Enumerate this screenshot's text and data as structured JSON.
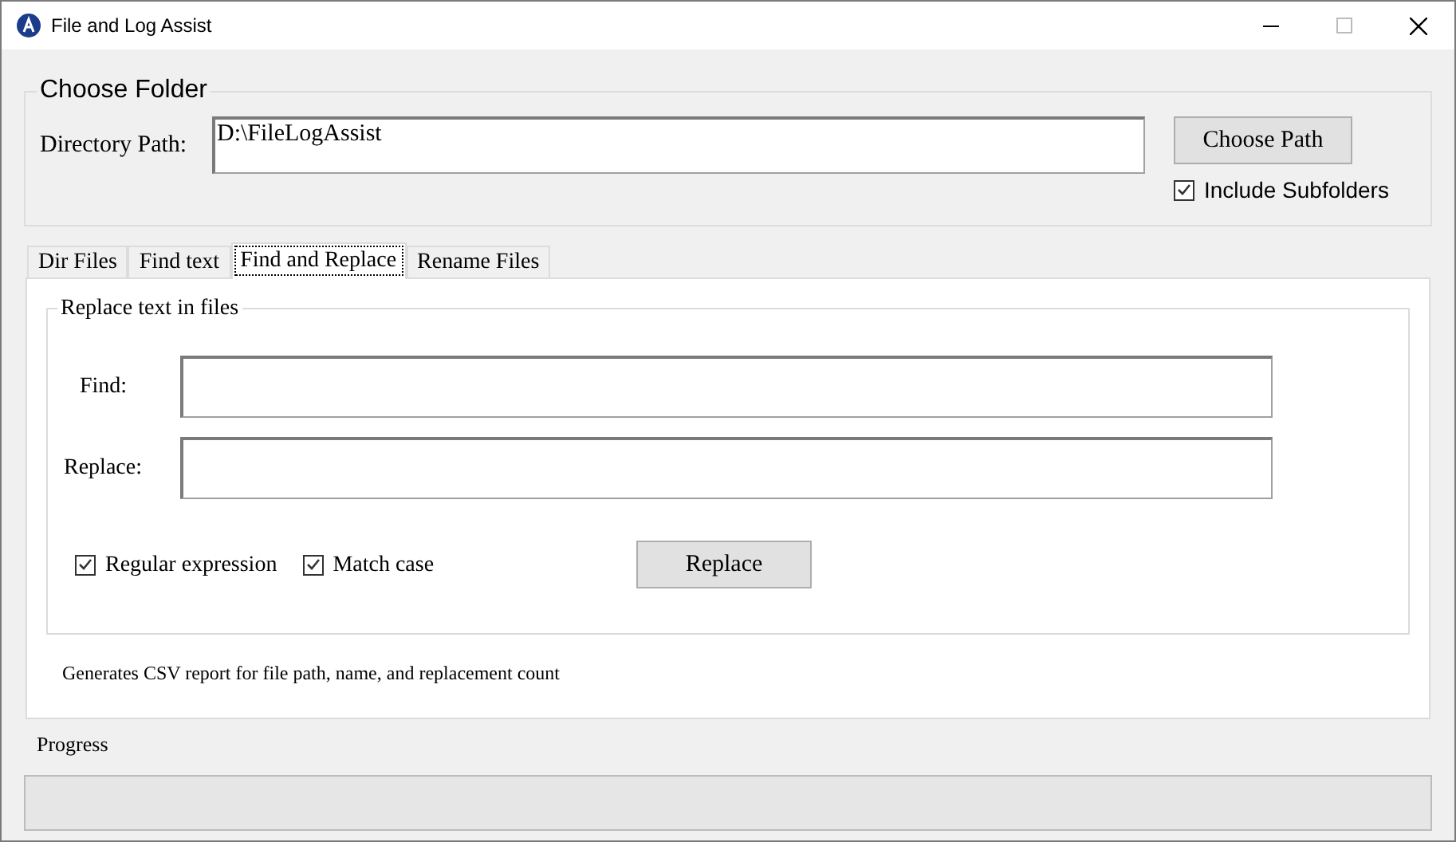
{
  "window": {
    "title": "File and Log Assist"
  },
  "choose_folder": {
    "title": "Choose Folder",
    "directory_label": "Directory Path:",
    "directory_value": "D:\\FileLogAssist",
    "choose_button": "Choose Path",
    "include_subfolders": {
      "label": "Include Subfolders",
      "checked": true
    }
  },
  "tabs": [
    {
      "label": "Dir Files",
      "selected": false
    },
    {
      "label": "Find text",
      "selected": false
    },
    {
      "label": "Find and Replace",
      "selected": true
    },
    {
      "label": "Rename Files",
      "selected": false
    }
  ],
  "replace_group": {
    "title": "Replace text in files",
    "find_label": "Find:",
    "replace_label": "Replace:",
    "options": [
      {
        "label": "Regular expression",
        "checked": true
      },
      {
        "label": "Match case",
        "checked": true
      }
    ],
    "replace_button": "Replace"
  },
  "note": "Generates CSV report for file path, name, and replacement count",
  "progress": {
    "label": "Progress",
    "level": 0
  }
}
